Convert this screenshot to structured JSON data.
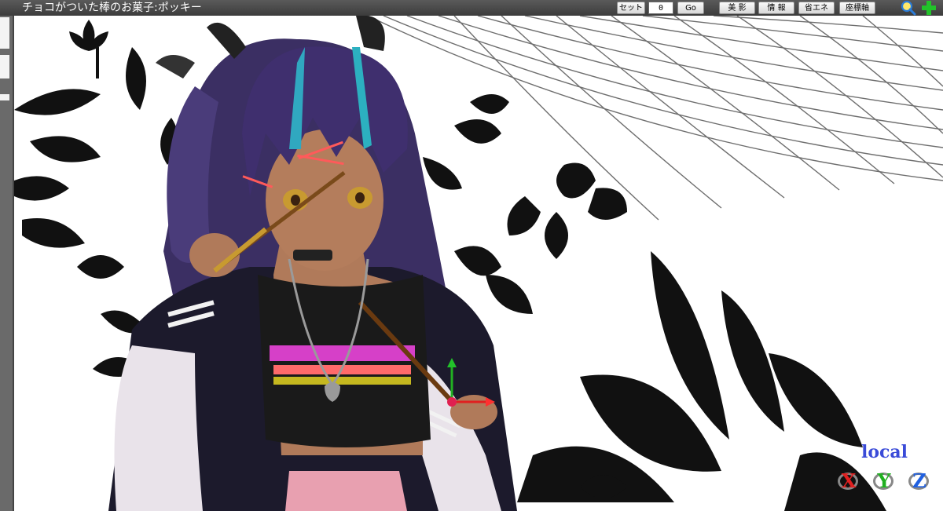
{
  "window": {
    "title": "チョコがついた棒のお菓子:ポッキー"
  },
  "toolbar": {
    "set_label": "セット",
    "frame_value": "0",
    "go_label": "Go",
    "shadow_label": "美 影",
    "info_label": "情 報",
    "energy_label": "省エネ",
    "axis_label": "座標軸",
    "zoom_icon": "magnifier-icon",
    "move_icon": "move-cross-icon"
  },
  "viewport": {
    "mode_label": "local",
    "axes": [
      {
        "label": "X",
        "color": "#e02020"
      },
      {
        "label": "Y",
        "color": "#20b020"
      },
      {
        "label": "Z",
        "color": "#2060e0"
      }
    ]
  },
  "colors": {
    "titlebar": "#4a4a4a",
    "accent_blue": "#3a4bd8"
  }
}
